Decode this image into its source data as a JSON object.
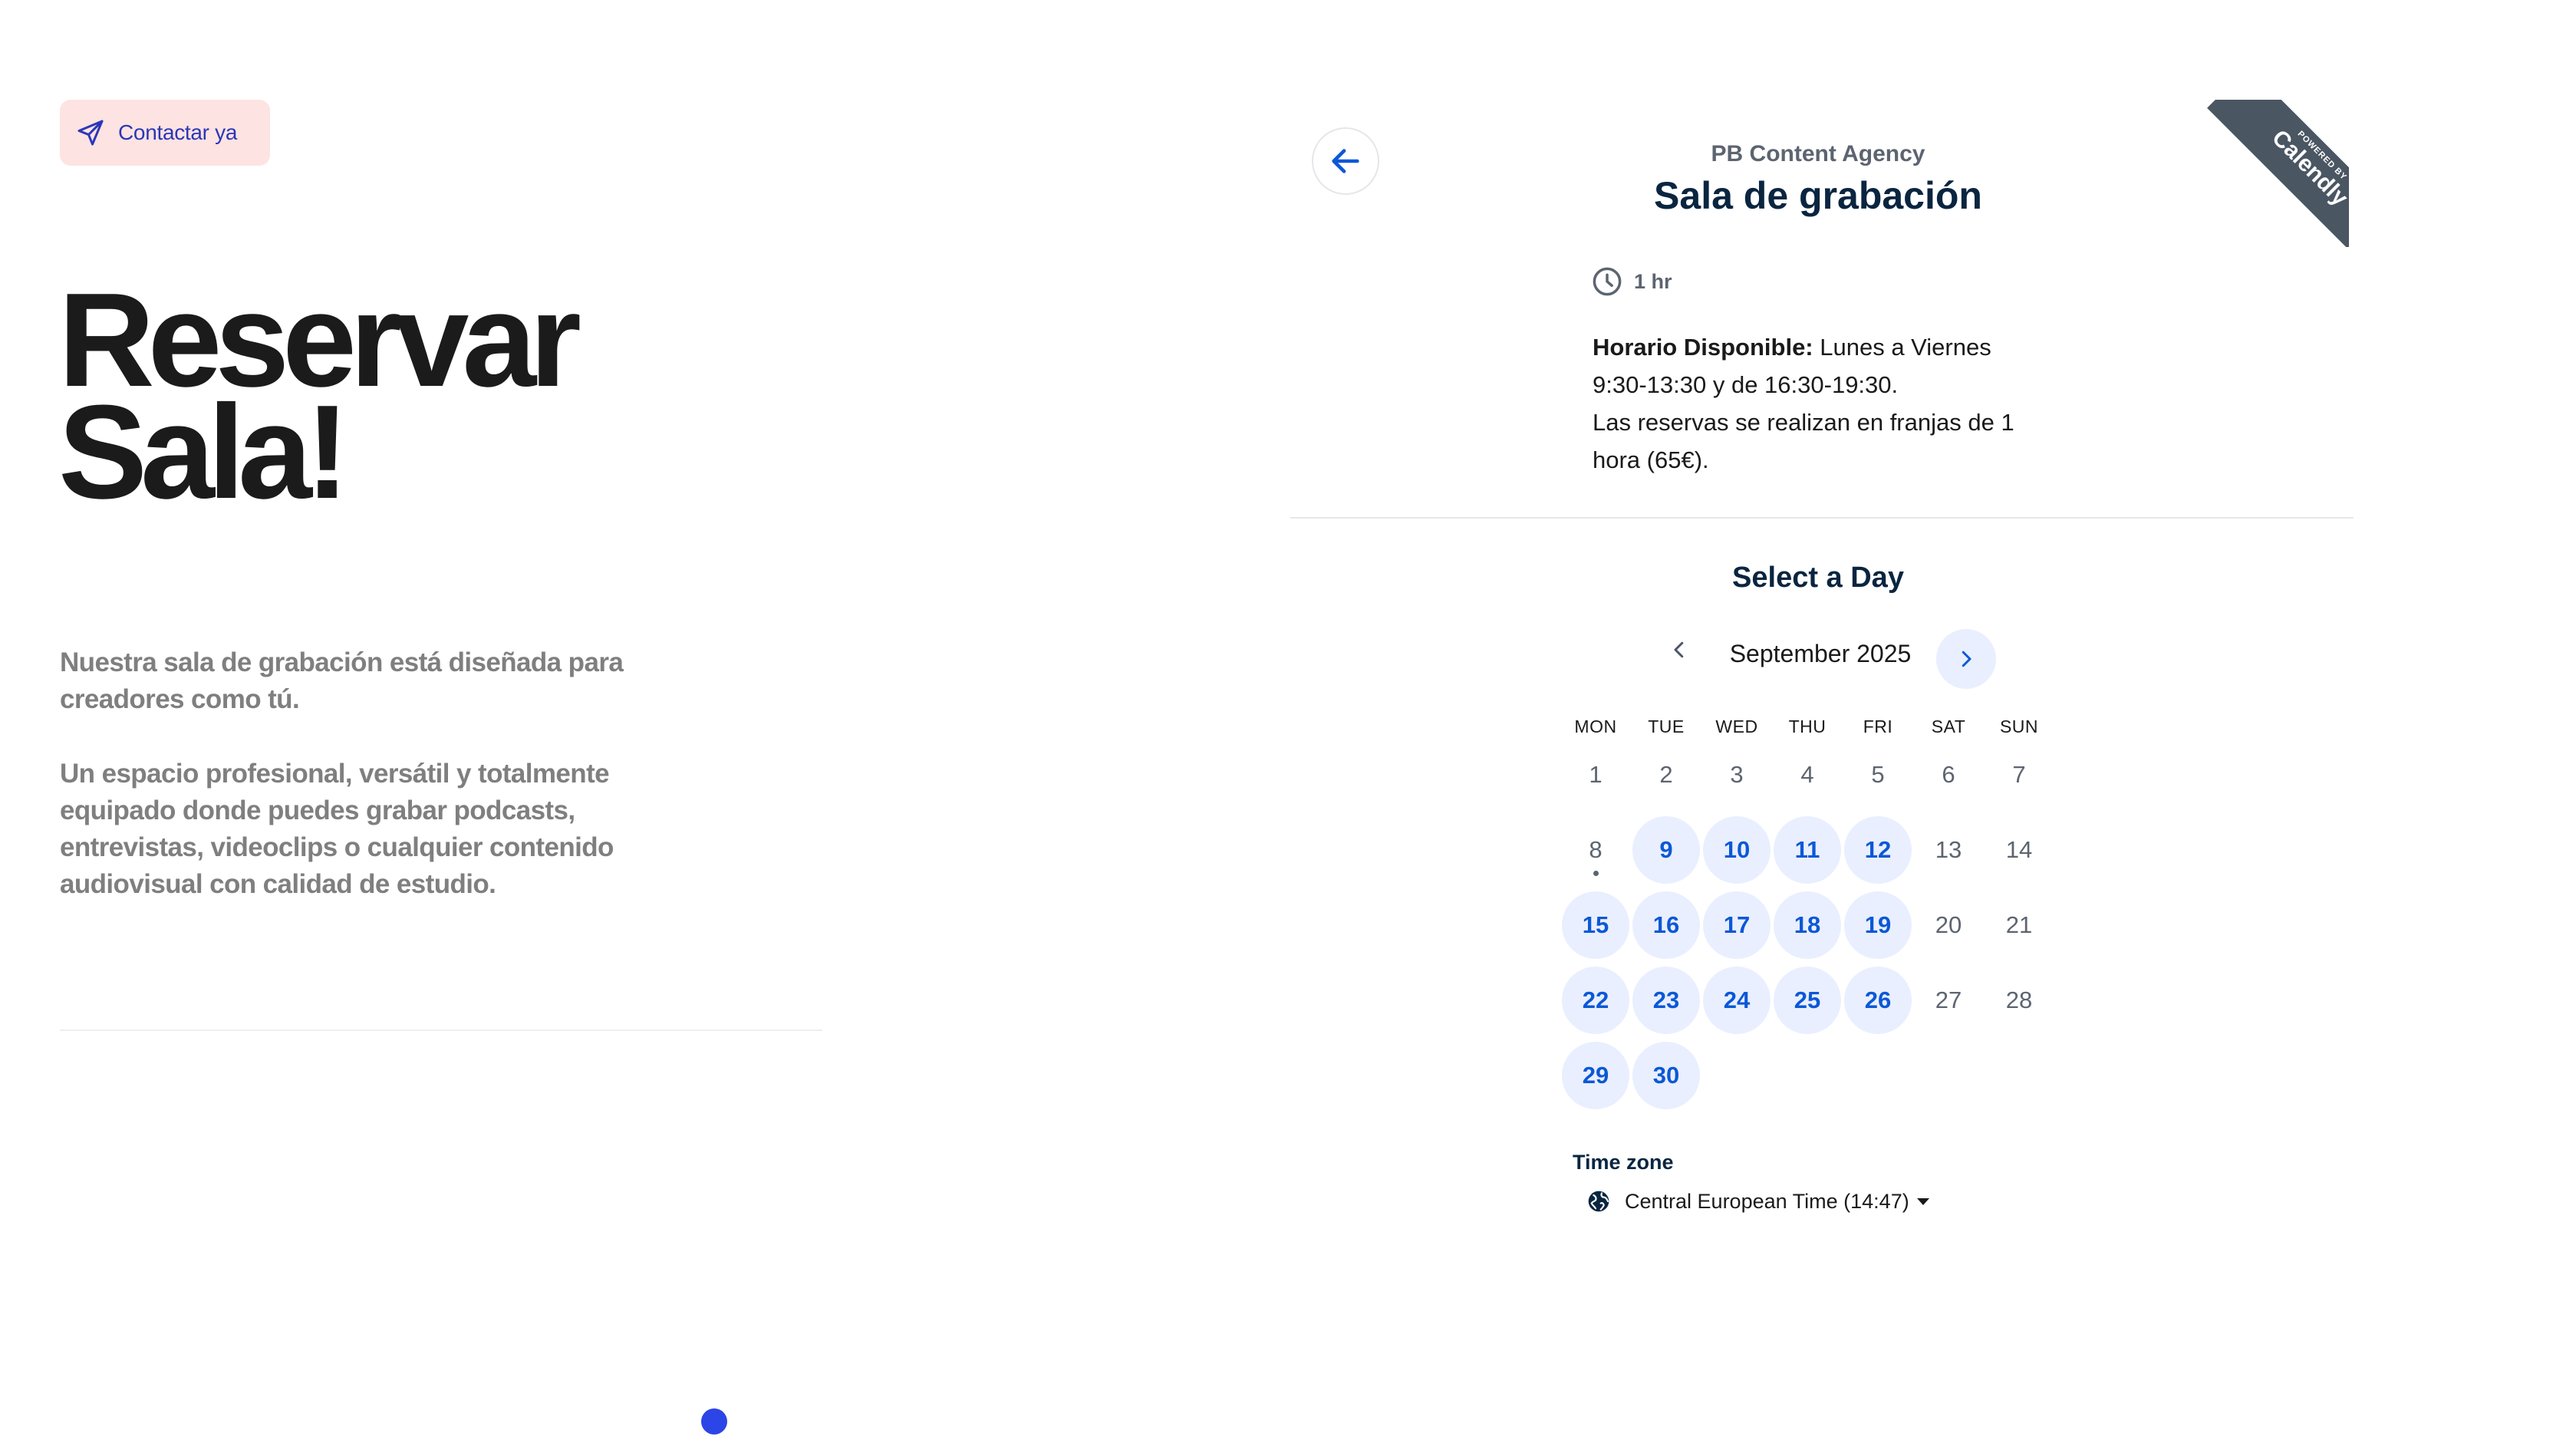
{
  "left": {
    "contact_label": "Contactar ya",
    "title_line1": "Reservar",
    "title_line2": "Sala!",
    "desc1": "Nuestra sala de grabación está diseñada para creadores como tú.",
    "desc2": "Un espacio profesional, versátil y totalmente equipado donde puedes grabar podcasts, entrevistas, videoclips o cualquier contenido audiovisual con calidad de estudio."
  },
  "calendly": {
    "org_name": "PB Content Agency",
    "event_title": "Sala de grabación",
    "ribbon_powered": "POWERED BY",
    "ribbon_brand": "Calendly",
    "duration": "1 hr",
    "description_label": "Horario Disponible:",
    "description_line1": " Lunes a Viernes",
    "description_line2": "9:30-13:30 y de 16:30-19:30.",
    "description_line3": "Las reservas se realizan en franjas de 1",
    "description_line4": "hora (65€).",
    "select_title": "Select a Day",
    "month": "September 2025",
    "weekdays": [
      "MON",
      "TUE",
      "WED",
      "THU",
      "FRI",
      "SAT",
      "SUN"
    ],
    "weeks": [
      [
        {
          "d": "1",
          "a": false
        },
        {
          "d": "2",
          "a": false
        },
        {
          "d": "3",
          "a": false
        },
        {
          "d": "4",
          "a": false
        },
        {
          "d": "5",
          "a": false
        },
        {
          "d": "6",
          "a": false
        },
        {
          "d": "7",
          "a": false
        }
      ],
      [
        {
          "d": "8",
          "a": false,
          "today": true
        },
        {
          "d": "9",
          "a": true
        },
        {
          "d": "10",
          "a": true
        },
        {
          "d": "11",
          "a": true
        },
        {
          "d": "12",
          "a": true
        },
        {
          "d": "13",
          "a": false
        },
        {
          "d": "14",
          "a": false
        }
      ],
      [
        {
          "d": "15",
          "a": true
        },
        {
          "d": "16",
          "a": true
        },
        {
          "d": "17",
          "a": true
        },
        {
          "d": "18",
          "a": true
        },
        {
          "d": "19",
          "a": true
        },
        {
          "d": "20",
          "a": false
        },
        {
          "d": "21",
          "a": false
        }
      ],
      [
        {
          "d": "22",
          "a": true
        },
        {
          "d": "23",
          "a": true
        },
        {
          "d": "24",
          "a": true
        },
        {
          "d": "25",
          "a": true
        },
        {
          "d": "26",
          "a": true
        },
        {
          "d": "27",
          "a": false
        },
        {
          "d": "28",
          "a": false
        }
      ],
      [
        {
          "d": "29",
          "a": true
        },
        {
          "d": "30",
          "a": true
        }
      ]
    ],
    "timezone_label": "Time zone",
    "timezone_value": "Central European Time (14:47)"
  },
  "colors": {
    "accent": "#0b58d6",
    "available_bg": "#e9efff",
    "contact_bg": "#fde3e1",
    "contact_text": "#2b37b8",
    "dot": "#2c45e6"
  }
}
